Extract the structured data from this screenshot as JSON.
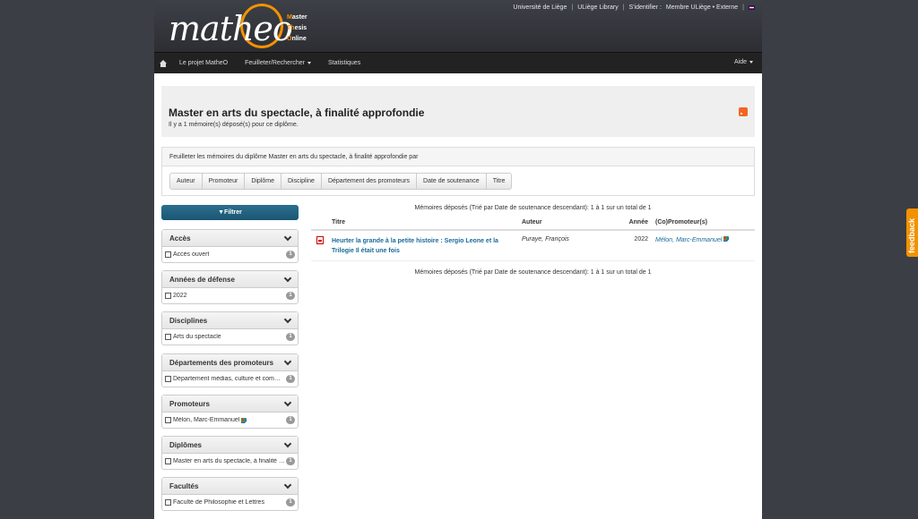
{
  "header": {
    "logo_text": "matheo",
    "logo_sub": [
      {
        "first": "M",
        "rest": "aster"
      },
      {
        "first": "Th",
        "rest": "esis"
      },
      {
        "first": "O",
        "rest": "nline"
      }
    ],
    "top_links": [
      "Université de Liège",
      "ULiège Library",
      "S'identifier :",
      "Membre ULiège • Externe"
    ]
  },
  "navbar": {
    "items": [
      "Le projet MatheO",
      "Feuilleter/Rechercher",
      "Statistiques"
    ],
    "aide": "Aide"
  },
  "title_box": {
    "title": "Master en arts du spectacle, à finalité approfondie",
    "count": "Il y a 1 mémoire(s) déposé(s) pour ce diplôme."
  },
  "browse": {
    "heading": "Feuilleter les mémoires du diplôme Master en arts du spectacle, à finalité approfondie par",
    "buttons": [
      "Auteur",
      "Promoteur",
      "Diplôme",
      "Discipline",
      "Département des promoteurs",
      "Date de soutenance",
      "Titre"
    ]
  },
  "filter_label": "Filtrer",
  "facets": [
    {
      "title": "Accès",
      "item": "Accès ouvert",
      "count": "1"
    },
    {
      "title": "Années de défense",
      "item": "2022",
      "count": "1"
    },
    {
      "title": "Disciplines",
      "item": "Arts du spectacle",
      "count": "1"
    },
    {
      "title": "Départements des promoteurs",
      "item": "Département médias, culture et communication",
      "count": "1"
    },
    {
      "title": "Promoteurs",
      "item": "Mélon, Marc-Emmanuel",
      "count": "1"
    },
    {
      "title": "Diplômes",
      "item": "Master en arts du spectacle, à finalité approfondie",
      "count": "1"
    },
    {
      "title": "Facultés",
      "item": "Faculté de Philosophie et Lettres",
      "count": "1"
    }
  ],
  "results": {
    "info": "Mémoires déposés (Trié par Date de soutenance descendant): 1 à 1 sur un total de 1",
    "columns": [
      "Titre",
      "Auteur",
      "Année",
      "(Co)Promoteur(s)"
    ],
    "rows": [
      {
        "title": "Heurter la grande à la petite histoire : Sergio Leone et la Trilogie Il était une fois",
        "author": "Puraye, François",
        "year": "2022",
        "promoter": "Mélon, Marc-Emmanuel"
      }
    ]
  },
  "feedback": "feedback"
}
